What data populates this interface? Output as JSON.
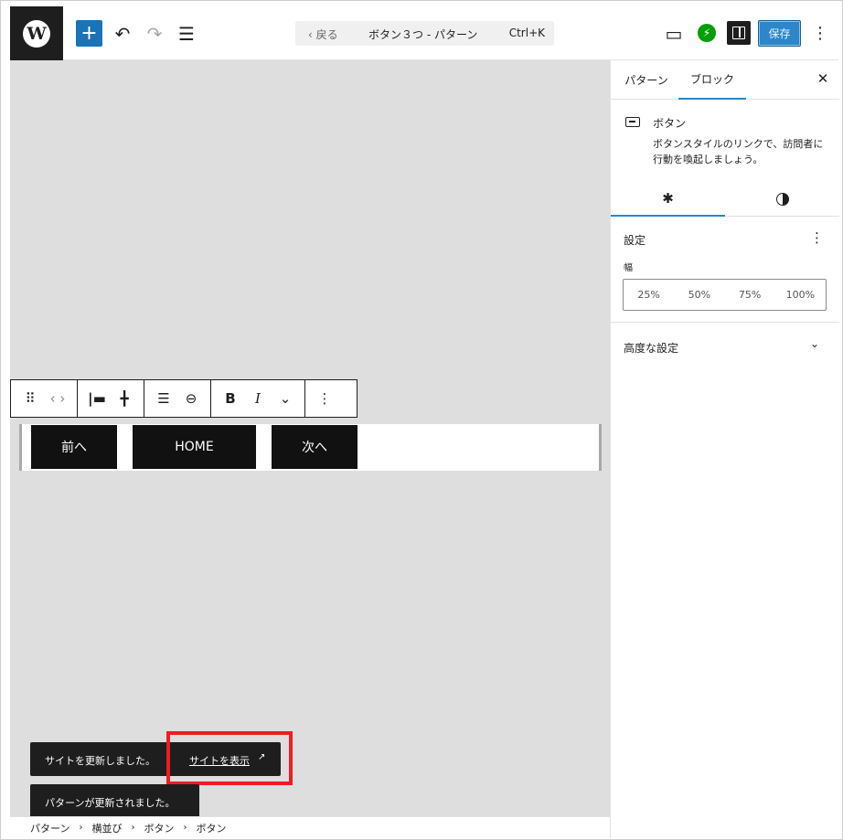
{
  "header": {
    "wp_logo_letter": "W",
    "add_label": "+",
    "undo_glyph": "↶",
    "redo_glyph": "↷",
    "list_glyph": "☰",
    "doc_back": "‹  戻る",
    "doc_title": "ボタン３つ - パターン",
    "doc_shortcut": "Ctrl+K",
    "device_glyph": "▭",
    "jetpack_glyph": "⚡",
    "save_label": "保存",
    "more_glyph": "⋮"
  },
  "block_toolbar": {
    "drag_glyph": "⠿",
    "move_glyph": "‹ ›",
    "align_left_glyph": "|▬",
    "justify_glyph": "╋",
    "text_align_glyph": "☰",
    "link_glyph": "⊖",
    "bold_glyph": "B",
    "italic_glyph": "I",
    "more_rich_glyph": "⌄",
    "options_glyph": "⋮"
  },
  "canvas": {
    "buttons": [
      {
        "label": "前へ"
      },
      {
        "label": "HOME"
      },
      {
        "label": "次へ"
      }
    ]
  },
  "snackbars": {
    "site_updated": "サイトを更新しました。",
    "view_site": "サイトを表示",
    "view_site_icon": "↗",
    "pattern_updated": "パターンが更新されました。"
  },
  "breadcrumb": {
    "items": [
      "パターン",
      "横並び",
      "ボタン",
      "ボタン"
    ],
    "separator": "›"
  },
  "sidebar": {
    "tabs": [
      {
        "label": "パターン"
      },
      {
        "label": "ブロック"
      }
    ],
    "close_glyph": "✕",
    "block_card": {
      "title": "ボタン",
      "description": "ボタンスタイルのリンクで、訪問者に行動を喚起しましょう。"
    },
    "settings_glyph": "✱",
    "settings": {
      "heading": "設定",
      "width_label": "幅",
      "width_options": [
        "25%",
        "50%",
        "75%",
        "100%"
      ],
      "kebab_glyph": "⋮"
    },
    "advanced": {
      "heading": "高度な設定",
      "chevron": "⌄"
    }
  },
  "colors": {
    "accent": "#2c86c9",
    "highlight": "#ee1c24",
    "button_bg": "#111111",
    "canvas_bg": "#dedede"
  }
}
